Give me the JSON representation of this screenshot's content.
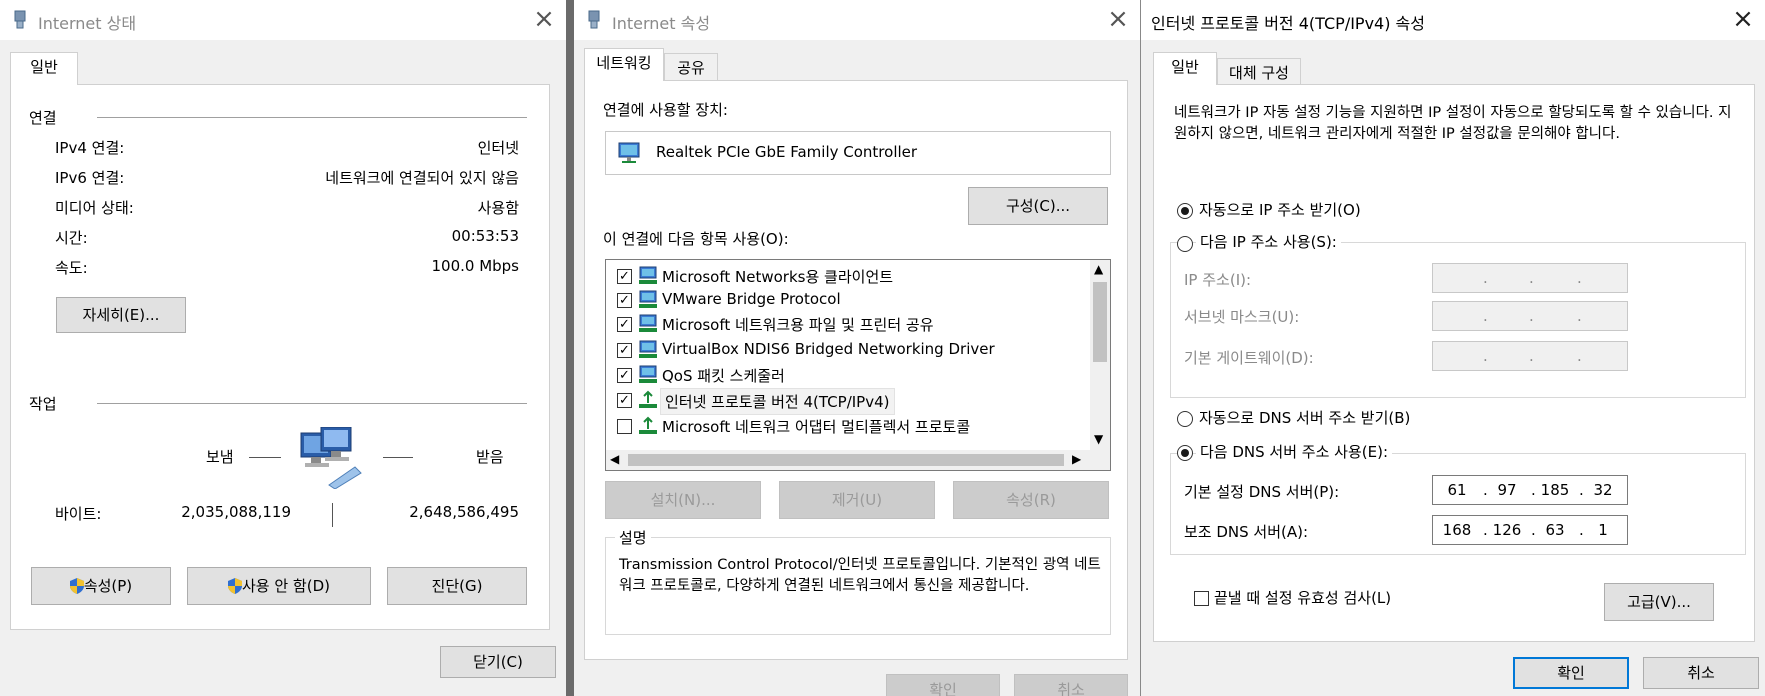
{
  "status_dialog": {
    "title": "Internet 상태",
    "tab_general": "일반",
    "connection": {
      "section": "연결",
      "rows": [
        {
          "label": "IPv4 연결:",
          "value": "인터넷"
        },
        {
          "label": "IPv6 연결:",
          "value": "네트워크에 연결되어 있지 않음"
        },
        {
          "label": "미디어 상태:",
          "value": "사용함"
        },
        {
          "label": "시간:",
          "value": "00:53:53"
        },
        {
          "label": "속도:",
          "value": "100.0 Mbps"
        }
      ],
      "details_button": "자세히(E)..."
    },
    "activity": {
      "section": "작업",
      "sent_label": "보냄",
      "received_label": "받음",
      "bytes_label": "바이트:",
      "bytes_sent": "2,035,088,119",
      "bytes_received": "2,648,586,495"
    },
    "buttons": {
      "properties": "속성(P)",
      "disable": "사용 안 함(D)",
      "diagnose": "진단(G)",
      "close": "닫기(C)"
    }
  },
  "props_dialog": {
    "title": "Internet 속성",
    "tabs": [
      "네트워킹",
      "공유"
    ],
    "connect_using_label": "연결에 사용할 장치:",
    "adapter_name": "Realtek PCIe GbE Family Controller",
    "configure_button": "구성(C)...",
    "items_label": "이 연결에 다음 항목 사용(O):",
    "items": [
      {
        "label": "Microsoft Networks용 클라이언트",
        "checked": true,
        "icon": "network-client-icon"
      },
      {
        "label": "VMware Bridge Protocol",
        "checked": true,
        "icon": "network-service-icon"
      },
      {
        "label": "Microsoft 네트워크용 파일 및 프린터 공유",
        "checked": true,
        "icon": "network-service-icon"
      },
      {
        "label": "VirtualBox NDIS6 Bridged Networking Driver",
        "checked": true,
        "icon": "network-service-icon"
      },
      {
        "label": "QoS 패킷 스케줄러",
        "checked": true,
        "icon": "network-service-icon"
      },
      {
        "label": "인터넷 프로토콜 버전 4(TCP/IPv4)",
        "checked": true,
        "icon": "protocol-icon"
      },
      {
        "label": "Microsoft 네트워크 어댑터 멀티플렉서 프로토콜",
        "checked": false,
        "icon": "protocol-icon"
      }
    ],
    "install_button": "설치(N)...",
    "uninstall_button": "제거(U)",
    "properties_button": "속성(R)",
    "description_label": "설명",
    "description_text": "Transmission Control Protocol/인터넷 프로토콜입니다. 기본적인 광역 네트워크 프로토콜로, 다양하게 연결된 네트워크에서 통신을 제공합니다.",
    "ok_button": "확인",
    "cancel_button": "취소"
  },
  "ipv4_dialog": {
    "title": "인터넷 프로토콜 버전 4(TCP/IPv4) 속성",
    "tabs": [
      "일반",
      "대체 구성"
    ],
    "intro": "네트워크가 IP 자동 설정 기능을 지원하면 IP 설정이 자동으로 할당되도록 할 수 있습니다. 지원하지 않으면, 네트워크 관리자에게 적절한 IP 설정값을 문의해야 합니다.",
    "auto_ip": "자동으로 IP 주소 받기(O)",
    "manual_ip": "다음 IP 주소 사용(S):",
    "ip_address_label": "IP 주소(I):",
    "subnet_label": "서브넷 마스크(U):",
    "gateway_label": "기본 게이트웨이(D):",
    "auto_dns": "자동으로 DNS 서버 주소 받기(B)",
    "manual_dns": "다음 DNS 서버 주소 사용(E):",
    "preferred_dns_label": "기본 설정 DNS 서버(P):",
    "preferred_dns": [
      "61",
      "97",
      "185",
      "32"
    ],
    "alternate_dns_label": "보조 DNS 서버(A):",
    "alternate_dns": [
      "168",
      "126",
      "63",
      "1"
    ],
    "validate_label": "끝낼 때 설정 유효성 검사(L)",
    "advanced_button": "고급(V)...",
    "ok_button": "확인",
    "cancel_button": "취소"
  }
}
